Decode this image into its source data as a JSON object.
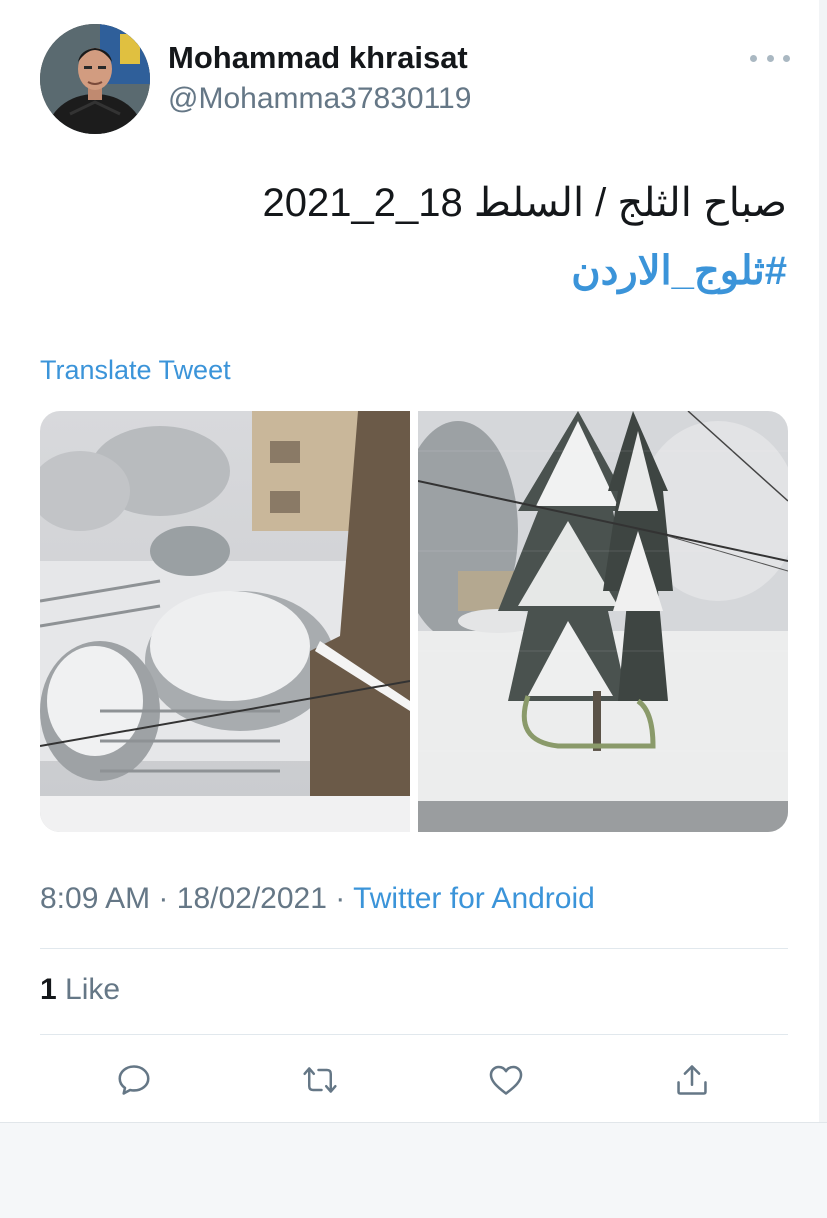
{
  "author": {
    "display_name": "Mohammad khraisat",
    "handle": "@Mohamma37830119",
    "avatar": "avatar-photo"
  },
  "tweet": {
    "text_line1": "صباح الثلج / السلط 18_2_2021",
    "hashtag": "#ثلوج_الاردن",
    "translate_label": "Translate Tweet"
  },
  "media": [
    {
      "name": "snowy-courtyard-photo"
    },
    {
      "name": "snowy-tree-photo"
    }
  ],
  "meta": {
    "time": "8:09 AM",
    "separator": "·",
    "date": "18/02/2021",
    "source": "Twitter for Android"
  },
  "engagement": {
    "like_count": "1",
    "like_label": "Like"
  },
  "actions": [
    {
      "icon": "reply-icon"
    },
    {
      "icon": "retweet-icon"
    },
    {
      "icon": "like-icon"
    },
    {
      "icon": "share-icon"
    }
  ],
  "colors": {
    "link": "#3b94d9",
    "secondary_text": "#657786",
    "primary_text": "#14171a",
    "icon": "#657786"
  }
}
